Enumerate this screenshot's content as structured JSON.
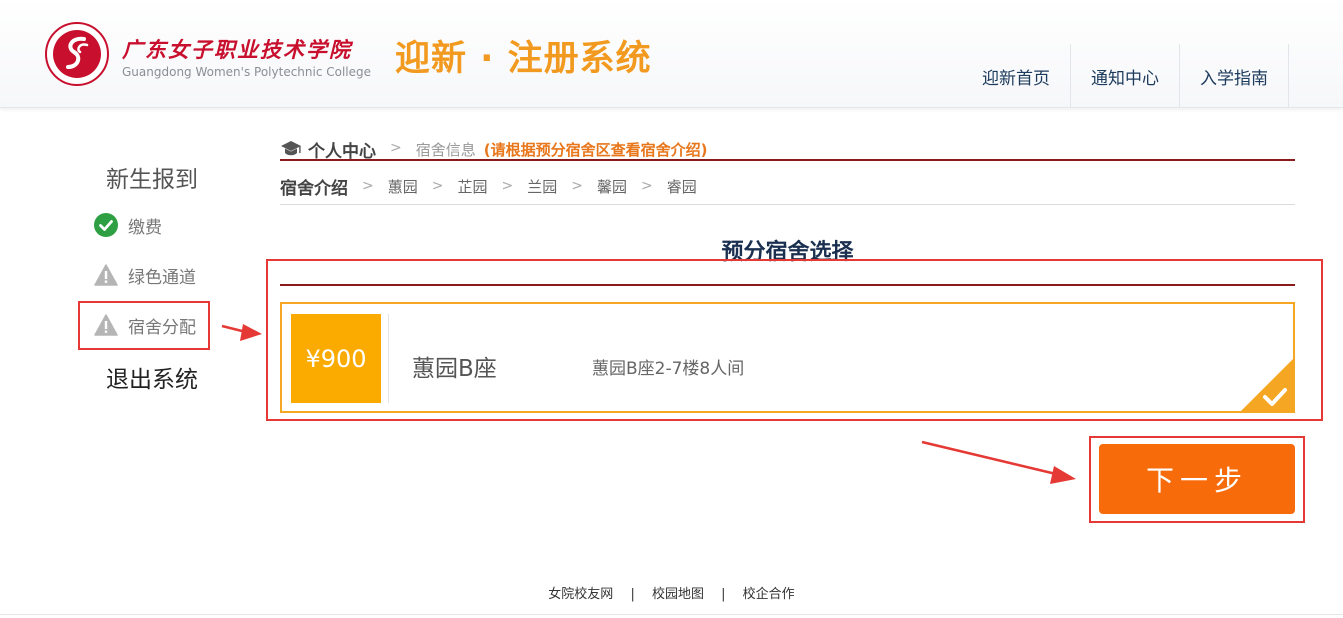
{
  "header": {
    "college_name_cn": "广东女子职业技术学院",
    "college_name_en": "Guangdong Women's Polytechnic College",
    "system_title": "迎新 · 注册系统",
    "nav": [
      "迎新首页",
      "通知中心",
      "入学指南"
    ]
  },
  "sidebar": {
    "title": "新生报到",
    "items": [
      {
        "label": "缴费",
        "status": "done",
        "icon": "check-circle-icon",
        "color": "#2ea043"
      },
      {
        "label": "绿色通道",
        "status": "warning",
        "icon": "warning-icon",
        "color": "#b5b5b5"
      },
      {
        "label": "宿舍分配",
        "status": "warning",
        "icon": "warning-icon",
        "color": "#b5b5b5"
      }
    ],
    "exit": "退出系统"
  },
  "breadcrumb": {
    "home": "个人中心",
    "current": "宿舍信息",
    "hint": "(请根据预分宿舍区查看宿舍介绍)"
  },
  "dorm_intro": {
    "label": "宿舍介绍",
    "gardens": [
      "蕙园",
      "芷园",
      "兰园",
      "馨园",
      "睿园"
    ]
  },
  "section": {
    "title": "预分宿舍选择"
  },
  "room_card": {
    "price": "¥900",
    "name": "蕙园B座",
    "description": "蕙园B座2-7楼8人间",
    "selected": true
  },
  "next_button": "下一步",
  "footer": {
    "links": [
      "女院校友网",
      "校园地图",
      "校企合作"
    ],
    "separator": "|"
  },
  "colors": {
    "accent_orange": "#f29a1f",
    "button_orange": "#f76b0a",
    "price_yellow": "#fbab00",
    "brand_red": "#c8102e",
    "divider_dark_red": "#8b1a1a",
    "annotation_red": "#e53935"
  }
}
